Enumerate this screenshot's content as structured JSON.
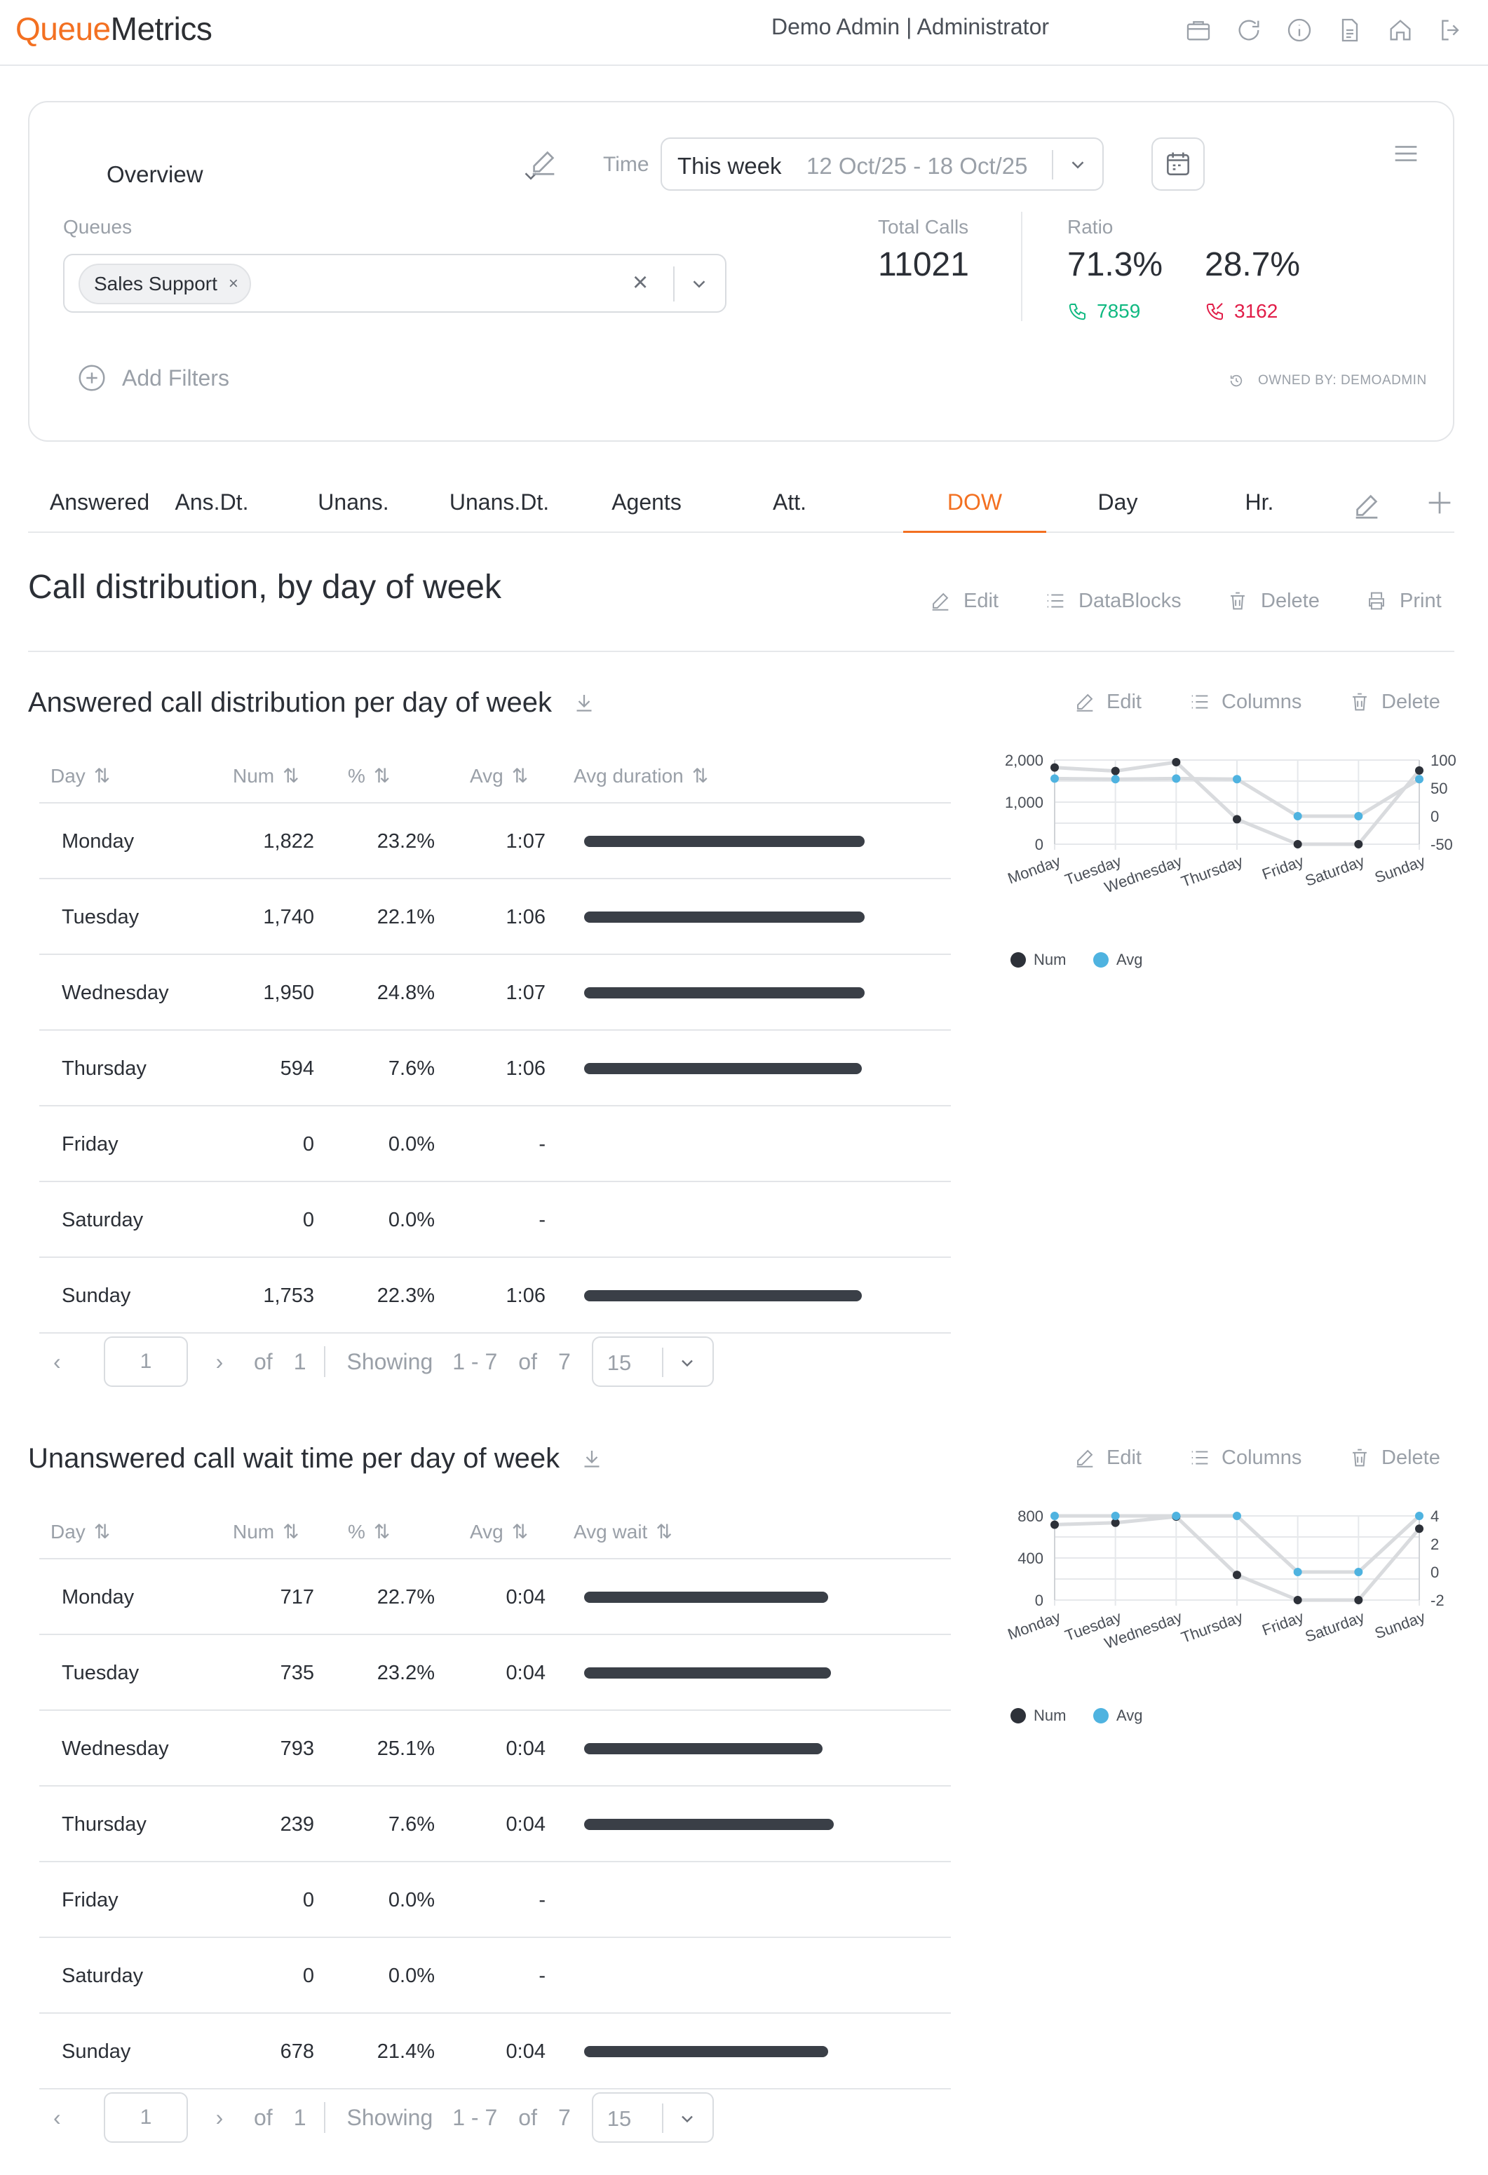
{
  "header": {
    "logo_part1": "Queue",
    "logo_part2": "Metrics",
    "user_name": "Demo Admin",
    "separator": "|",
    "user_role": "Administrator",
    "icons": [
      "briefcase-icon",
      "refresh-icon",
      "info-icon",
      "document-icon",
      "home-icon",
      "logout-icon"
    ]
  },
  "overview": {
    "report_name": "Overview",
    "time_label": "Time",
    "time_value": "This week",
    "time_range": "12 Oct/25 - 18 Oct/25",
    "queues_label": "Queues",
    "queue_chip": "Sales Support",
    "chip_remove": "×",
    "clear": "×",
    "total_calls_label": "Total Calls",
    "total_calls": "11021",
    "ratio_label": "Ratio",
    "ratio_answered": "71.3%",
    "ratio_unanswered": "28.7%",
    "answered_count": "7859",
    "unanswered_count": "3162",
    "add_filters": "Add Filters",
    "owned_by": "OWNED BY: DEMOADMIN",
    "colors": {
      "answered": "#10b981",
      "unanswered": "#e11d48",
      "accent": "#f37021"
    }
  },
  "tabs": [
    {
      "label": "Answered"
    },
    {
      "label": "Ans.Dt."
    },
    {
      "label": "Unans."
    },
    {
      "label": "Unans.Dt."
    },
    {
      "label": "Agents"
    },
    {
      "label": "Att."
    },
    {
      "label": "DOW",
      "active": true
    },
    {
      "label": "Day"
    },
    {
      "label": "Hr."
    }
  ],
  "page": {
    "title": "Call distribution, by day of week",
    "actions": {
      "edit": "Edit",
      "datablocks": "DataBlocks",
      "delete": "Delete",
      "print": "Print"
    }
  },
  "block_actions": {
    "edit": "Edit",
    "columns": "Columns",
    "delete": "Delete"
  },
  "answered": {
    "title": "Answered call distribution per day of week",
    "columns": [
      "Day",
      "Num",
      "%",
      "Avg",
      "Avg duration"
    ],
    "rows": [
      {
        "day": "Monday",
        "num": "1,822",
        "pct": "23.2%",
        "avg": "1:07",
        "bar": 1.0
      },
      {
        "day": "Tuesday",
        "num": "1,740",
        "pct": "22.1%",
        "avg": "1:06",
        "bar": 1.0
      },
      {
        "day": "Wednesday",
        "num": "1,950",
        "pct": "24.8%",
        "avg": "1:07",
        "bar": 1.0
      },
      {
        "day": "Thursday",
        "num": "594",
        "pct": "7.6%",
        "avg": "1:06",
        "bar": 0.99
      },
      {
        "day": "Friday",
        "num": "0",
        "pct": "0.0%",
        "avg": "-",
        "bar": 0
      },
      {
        "day": "Saturday",
        "num": "0",
        "pct": "0.0%",
        "avg": "-",
        "bar": 0
      },
      {
        "day": "Sunday",
        "num": "1,753",
        "pct": "22.3%",
        "avg": "1:06",
        "bar": 0.99
      }
    ],
    "pager": {
      "page": "1",
      "of": "of",
      "total_pages": "1",
      "showing": "Showing",
      "range": "1 - 7",
      "of2": "of",
      "total": "7",
      "per_page": "15",
      "prev": "‹",
      "next": "›"
    }
  },
  "unanswered": {
    "title": "Unanswered call wait time per day of week",
    "columns": [
      "Day",
      "Num",
      "%",
      "Avg",
      "Avg wait"
    ],
    "rows": [
      {
        "day": "Monday",
        "num": "717",
        "pct": "22.7%",
        "avg": "0:04",
        "bar": 0.87
      },
      {
        "day": "Tuesday",
        "num": "735",
        "pct": "23.2%",
        "avg": "0:04",
        "bar": 0.88
      },
      {
        "day": "Wednesday",
        "num": "793",
        "pct": "25.1%",
        "avg": "0:04",
        "bar": 0.85
      },
      {
        "day": "Thursday",
        "num": "239",
        "pct": "7.6%",
        "avg": "0:04",
        "bar": 0.89
      },
      {
        "day": "Friday",
        "num": "0",
        "pct": "0.0%",
        "avg": "-",
        "bar": 0
      },
      {
        "day": "Saturday",
        "num": "0",
        "pct": "0.0%",
        "avg": "-",
        "bar": 0
      },
      {
        "day": "Sunday",
        "num": "678",
        "pct": "21.4%",
        "avg": "0:04",
        "bar": 0.87
      }
    ],
    "pager": {
      "page": "1",
      "of": "of",
      "total_pages": "1",
      "showing": "Showing",
      "range": "1 - 7",
      "of2": "of",
      "total": "7",
      "per_page": "15",
      "prev": "‹",
      "next": "›"
    }
  },
  "chart_data": [
    {
      "type": "line",
      "categories": [
        "Monday",
        "Tuesday",
        "Wednesday",
        "Thursday",
        "Friday",
        "Saturday",
        "Sunday"
      ],
      "series": [
        {
          "name": "Num",
          "axis": "left",
          "color": "#2d3139",
          "values": [
            1822,
            1740,
            1950,
            594,
            0,
            0,
            1753
          ]
        },
        {
          "name": "Avg",
          "axis": "right",
          "color": "#4fb3e0",
          "values": [
            67,
            66,
            67,
            66,
            0,
            0,
            66
          ]
        }
      ],
      "left_ticks": [
        "2,000",
        "1,000",
        "0"
      ],
      "right_ticks": [
        "100",
        "50",
        "0",
        "-50"
      ],
      "ylim_left": [
        0,
        2000
      ],
      "ylim_right": [
        -50,
        100
      ],
      "legend": "bottom-left",
      "grid": true
    },
    {
      "type": "line",
      "categories": [
        "Monday",
        "Tuesday",
        "Wednesday",
        "Thursday",
        "Friday",
        "Saturday",
        "Sunday"
      ],
      "series": [
        {
          "name": "Num",
          "axis": "left",
          "color": "#2d3139",
          "values": [
            717,
            735,
            793,
            239,
            0,
            0,
            678
          ]
        },
        {
          "name": "Avg",
          "axis": "right",
          "color": "#4fb3e0",
          "values": [
            4,
            4,
            4,
            4,
            0,
            0,
            4
          ]
        }
      ],
      "left_ticks": [
        "800",
        "400",
        "0"
      ],
      "right_ticks": [
        "4",
        "2",
        "0",
        "-2"
      ],
      "ylim_left": [
        0,
        800
      ],
      "ylim_right": [
        -2,
        4
      ],
      "legend": "bottom-left",
      "grid": true
    }
  ]
}
